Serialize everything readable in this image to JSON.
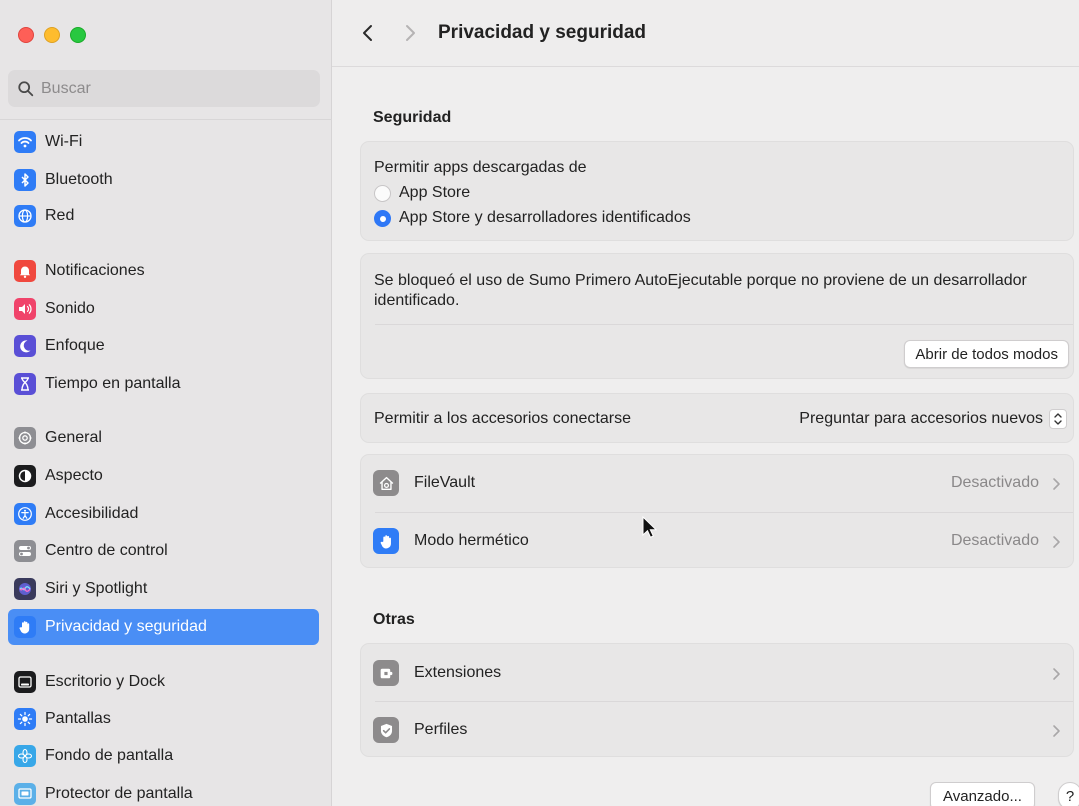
{
  "window": {
    "title": "Privacidad y seguridad"
  },
  "search": {
    "placeholder": "Buscar"
  },
  "sidebar": {
    "items": [
      {
        "label": "Wi-Fi",
        "icon": "wifi-icon",
        "color": "#2f7cf6"
      },
      {
        "label": "Bluetooth",
        "icon": "bluetooth-icon",
        "color": "#2f7cf6"
      },
      {
        "label": "Red",
        "icon": "globe-icon",
        "color": "#2f7cf6"
      },
      {
        "label": "Notificaciones",
        "icon": "bell-icon",
        "color": "#f0483e"
      },
      {
        "label": "Sonido",
        "icon": "speaker-icon",
        "color": "#f0436a"
      },
      {
        "label": "Enfoque",
        "icon": "moon-icon",
        "color": "#5a4fd6"
      },
      {
        "label": "Tiempo en pantalla",
        "icon": "hourglass-icon",
        "color": "#5a4fd6"
      },
      {
        "label": "General",
        "icon": "gear-icon",
        "color": "#8e8e93"
      },
      {
        "label": "Aspecto",
        "icon": "appearance-icon",
        "color": "#1c1c1e"
      },
      {
        "label": "Accesibilidad",
        "icon": "accessibility-icon",
        "color": "#2f7cf6"
      },
      {
        "label": "Centro de control",
        "icon": "toggles-icon",
        "color": "#8e8e93"
      },
      {
        "label": "Siri y Spotlight",
        "icon": "siri-icon",
        "color": "#3a3a5c"
      },
      {
        "label": "Privacidad y seguridad",
        "icon": "hand-icon",
        "color": "#2f7cf6"
      },
      {
        "label": "Escritorio y Dock",
        "icon": "dock-icon",
        "color": "#1c1c1e"
      },
      {
        "label": "Pantallas",
        "icon": "sun-icon",
        "color": "#2f7cf6"
      },
      {
        "label": "Fondo de pantalla",
        "icon": "flower-icon",
        "color": "#38a7e8"
      },
      {
        "label": "Protector de pantalla",
        "icon": "screensaver-icon",
        "color": "#5bb0e8"
      }
    ],
    "active_index": 12
  },
  "security": {
    "section_title": "Seguridad",
    "allow_apps_label": "Permitir apps descargadas de",
    "option_app_store": "App Store",
    "option_identified": "App Store y desarrolladores identificados",
    "selected_option": "App Store y desarrolladores identificados",
    "blocked_message": "Se bloqueó el uso de Sumo Primero AutoEjecutable porque no proviene de un desarrollador identificado.",
    "open_anyway_label": "Abrir de todos modos",
    "accessories_label": "Permitir a los accesorios conectarse",
    "accessories_value": "Preguntar para accesorios nuevos",
    "filevault_label": "FileVault",
    "filevault_value": "Desactivado",
    "lockdown_label": "Modo hermético",
    "lockdown_value": "Desactivado"
  },
  "others": {
    "section_title": "Otras",
    "extensions_label": "Extensiones",
    "profiles_label": "Perfiles"
  },
  "footer": {
    "advanced_label": "Avanzado...",
    "help_label": "?"
  },
  "colors": {
    "accent": "#2f78f6",
    "sidebar_selected": "#4a8ef5"
  }
}
